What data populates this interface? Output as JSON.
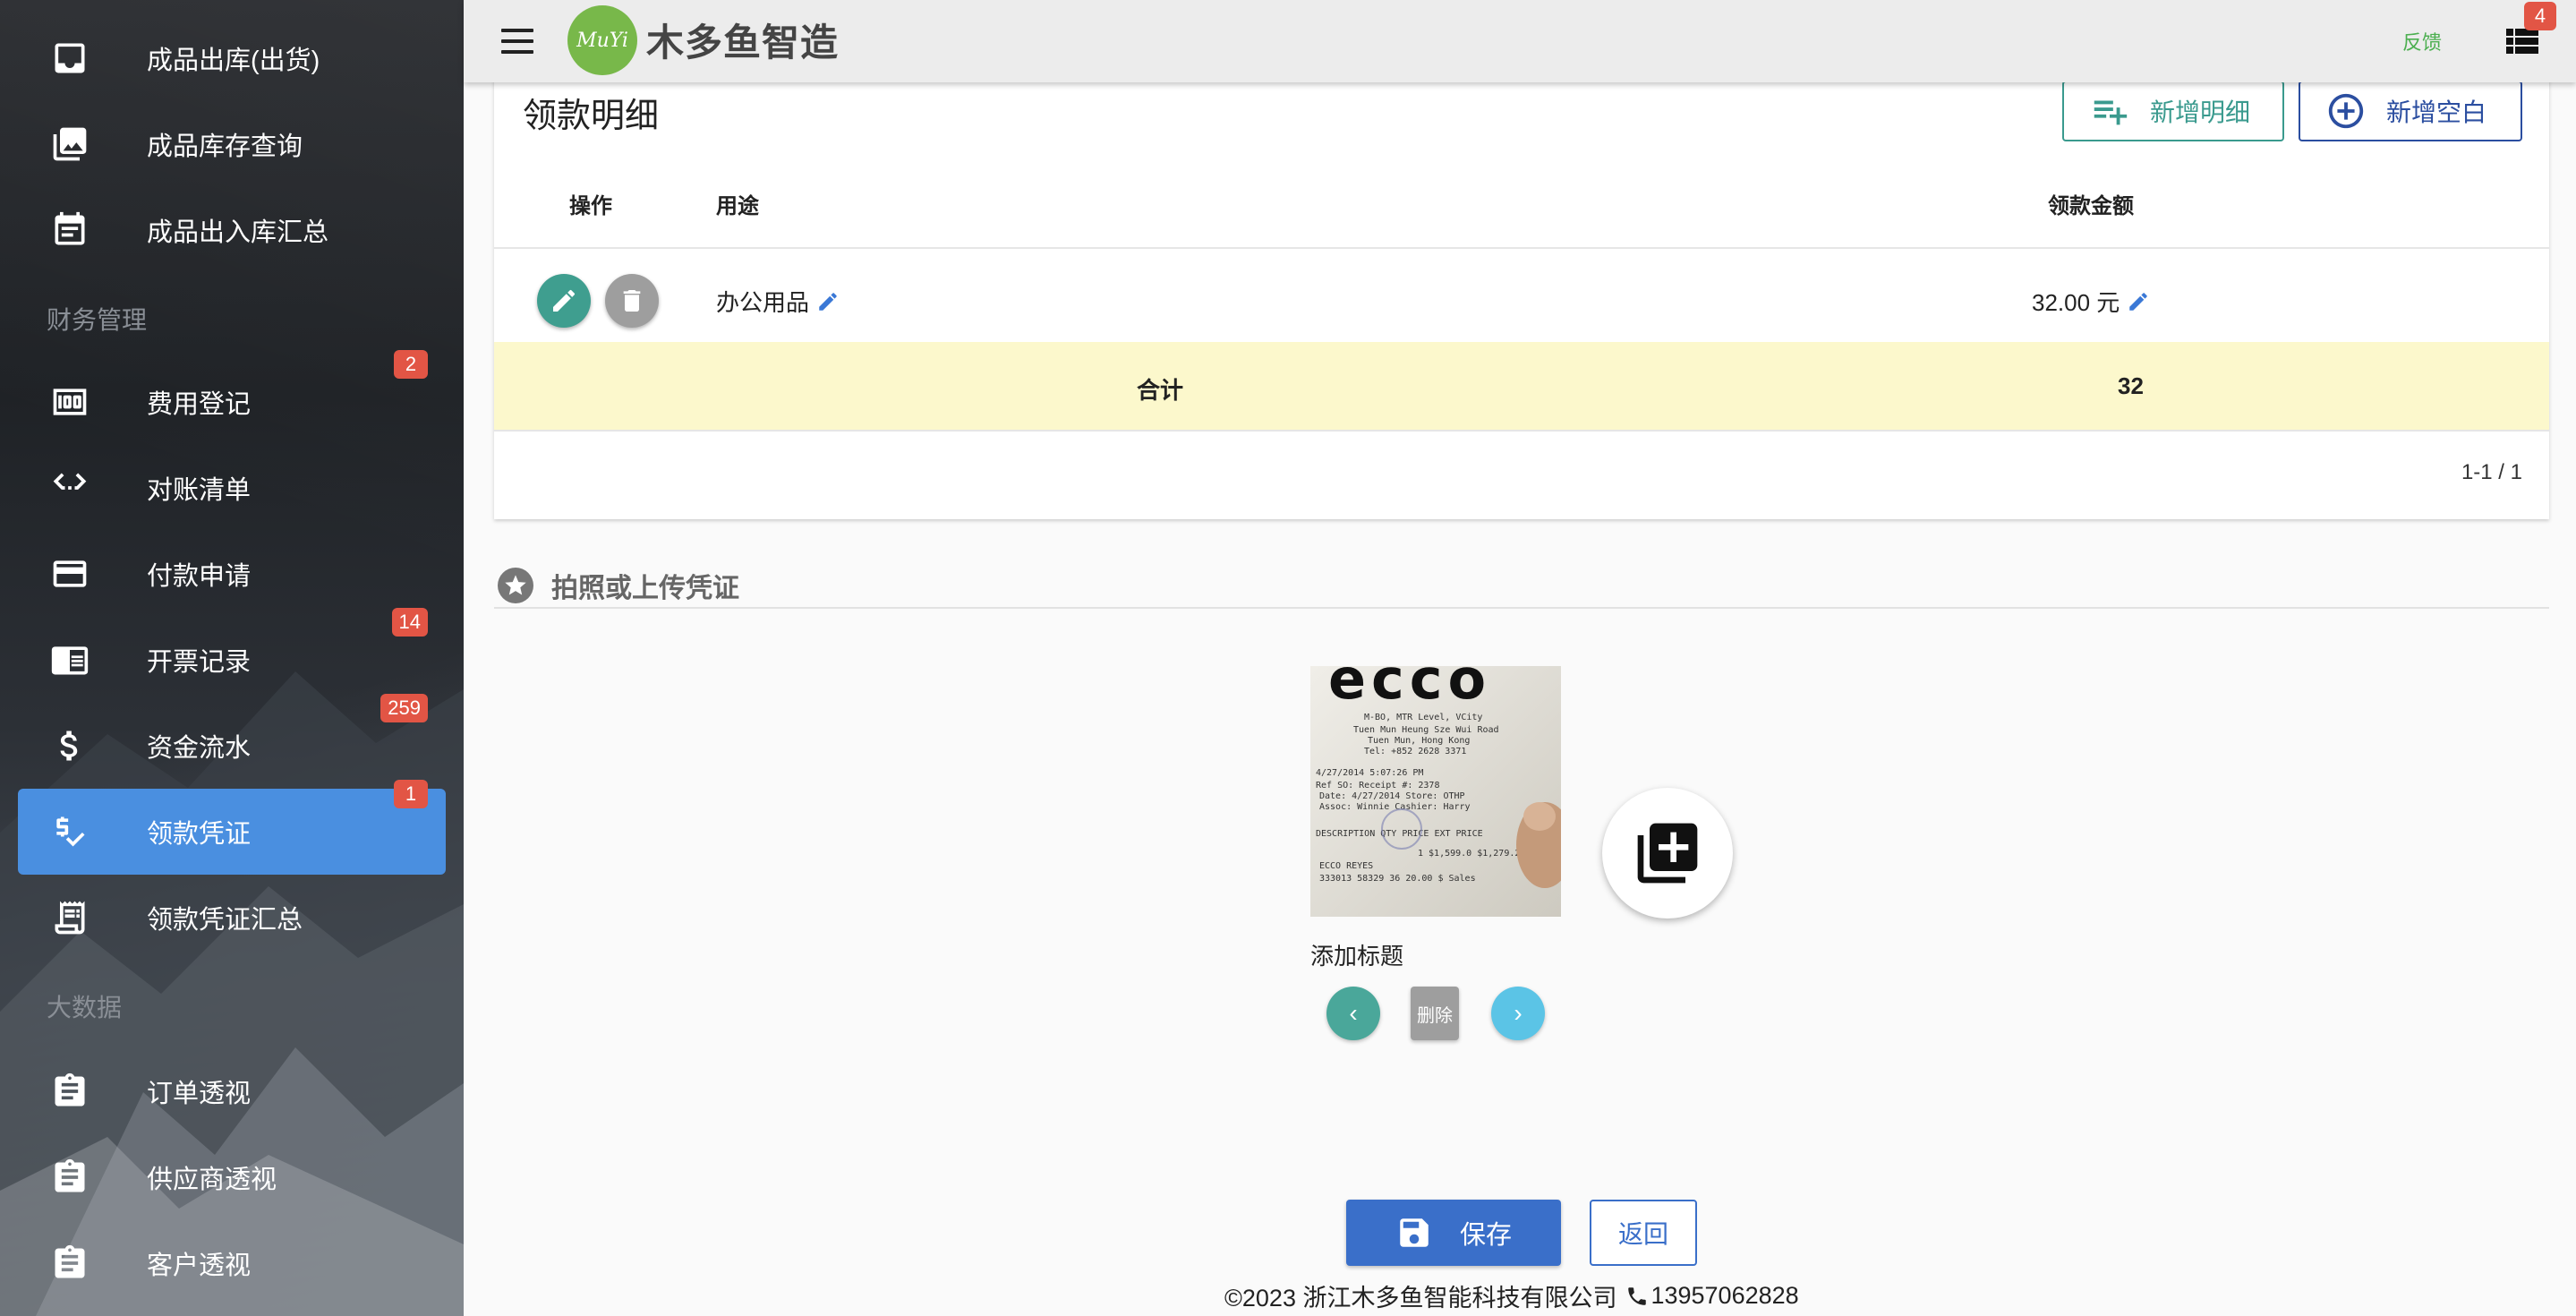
{
  "sidebar": {
    "items": [
      {
        "label": "成品出库(出货)",
        "icon": "inbox-icon"
      },
      {
        "label": "成品库存查询",
        "icon": "photo-library-icon"
      },
      {
        "label": "成品出入库汇总",
        "icon": "calendar-note-icon"
      },
      {
        "label": "费用登记",
        "icon": "money-icon",
        "badge": "2"
      },
      {
        "label": "对账清单",
        "icon": "code-dots-icon"
      },
      {
        "label": "付款申请",
        "icon": "credit-card-icon"
      },
      {
        "label": "开票记录",
        "icon": "chrome-reader-icon",
        "badge": "14"
      },
      {
        "label": "资金流水",
        "icon": "dollar-icon",
        "badge": "259"
      },
      {
        "label": "领款凭证",
        "icon": "price-check-icon",
        "badge": "1",
        "active": true
      },
      {
        "label": "领款凭证汇总",
        "icon": "receipt-long-icon"
      },
      {
        "label": "订单透视",
        "icon": "clipboard-icon"
      },
      {
        "label": "供应商透视",
        "icon": "clipboard-icon"
      },
      {
        "label": "客户透视",
        "icon": "clipboard-icon"
      }
    ],
    "sections": [
      "财务管理",
      "大数据"
    ]
  },
  "header": {
    "logo_text": "MuYi",
    "brand": "木多鱼智造",
    "feedback": "反馈",
    "list_badge": "4"
  },
  "card": {
    "title": "领款明细",
    "add_detail_label": "新增明细",
    "add_blank_label": "新增空白",
    "columns": [
      "操作",
      "用途",
      "领款金额"
    ],
    "rows": [
      {
        "purpose": "办公用品",
        "amount": "32.00 元"
      }
    ],
    "total_label": "合计",
    "total_value": "32",
    "pagination": "1-1 / 1"
  },
  "upload": {
    "title": "拍照或上传凭证",
    "image_caption": "添加标题",
    "delete_label": "删除",
    "receipt_lines": [
      "M-BO, MTR Level, VCity",
      "Tuen Mun Heung Sze Wui Road",
      "Tuen Mun, Hong Kong",
      "Tel: +852 2628 3371",
      "4/27/2014 5:07:26 PM",
      "Ref SO:          Receipt #:  2378",
      "Date: 4/27/2014   Store:  OTHP",
      "Assoc: Winnie     Cashier:  Harry",
      "DESCRIPTION    QTY PRICE   EXT PRICE",
      "1  $1,599.0  $1,279.2",
      "ECCO REYES",
      "333013 58329 36  20.00 $ Sales"
    ]
  },
  "actions": {
    "save_label": "保存",
    "back_label": "返回"
  },
  "footer": {
    "copyright": "©2023 浙江木多鱼智能科技有限公司",
    "phone": "13957062828"
  }
}
